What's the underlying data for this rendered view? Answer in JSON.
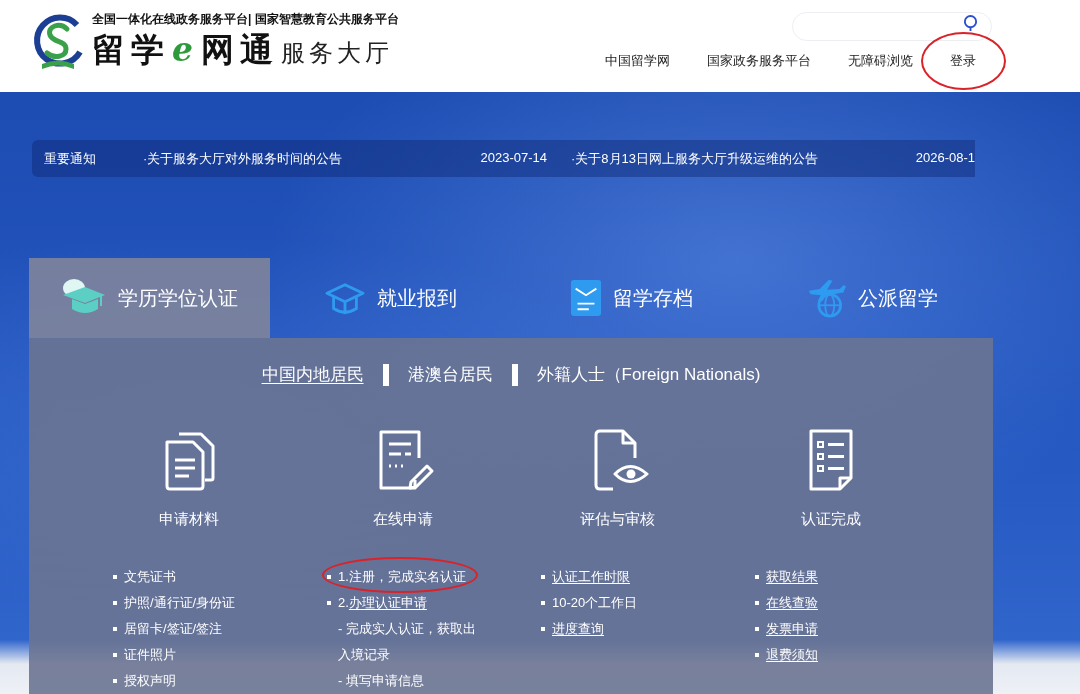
{
  "header": {
    "tagline": "全国一体化在线政务服务平台| 国家智慧教育公共服务平台",
    "logo_text": [
      {
        "text": "留学",
        "kind": "script"
      },
      {
        "text": "e",
        "kind": "accent"
      },
      {
        "text": "网通",
        "kind": "script"
      }
    ],
    "service_name": "服务大厅",
    "nav": [
      {
        "label": "中国留学网",
        "circled": false
      },
      {
        "label": "国家政务服务平台",
        "circled": false
      },
      {
        "label": "无障碍浏览",
        "circled": false
      },
      {
        "label": "登录",
        "circled": true
      }
    ]
  },
  "notice": {
    "label": "重要通知",
    "items": [
      {
        "title": "·关于服务大厅对外服务时间的公告",
        "date": "2023-07-14"
      },
      {
        "title": "·关于8月13日网上服务大厅升级运维的公告",
        "date": "2026-08-1"
      }
    ]
  },
  "tabs": [
    {
      "label": "学历学位认证",
      "selected": true
    },
    {
      "label": "就业报到",
      "selected": false
    },
    {
      "label": "留学存档",
      "selected": false
    },
    {
      "label": "公派留学",
      "selected": false
    }
  ],
  "sub_tabs": [
    {
      "label": "中国内地居民",
      "selected": true
    },
    {
      "label": "港澳台居民",
      "selected": false
    },
    {
      "label": "外籍人士（Foreign Nationals)",
      "selected": false
    }
  ],
  "steps": [
    {
      "title": "申请材料",
      "items": [
        {
          "kind": "bullet",
          "text": "文凭证书",
          "link": false,
          "circled": false
        },
        {
          "kind": "bullet",
          "text": "护照/通行证/身份证",
          "link": false,
          "circled": false
        },
        {
          "kind": "bullet",
          "text": "居留卡/签证/签注",
          "link": false,
          "circled": false
        },
        {
          "kind": "bullet",
          "text": "证件照片",
          "link": false,
          "circled": false
        },
        {
          "kind": "bullet",
          "text": "授权声明",
          "link": false,
          "circled": false
        }
      ]
    },
    {
      "title": "在线申请",
      "items": [
        {
          "kind": "bullet",
          "text": "1.注册，完成实名认证",
          "link": false,
          "circled": true
        },
        {
          "kind": "bullet",
          "prefix": "2.",
          "text": "办理认证申请",
          "link": true,
          "circled": false
        },
        {
          "kind": "dash",
          "text": "- 完成实人认证，获取出入境记录",
          "link": false,
          "circled": false
        },
        {
          "kind": "dash",
          "text": "- 填写申请信息",
          "link": false,
          "circled": false
        }
      ]
    },
    {
      "title": "评估与审核",
      "items": [
        {
          "kind": "bullet",
          "text": "认证工作时限",
          "link": true,
          "circled": false
        },
        {
          "kind": "bullet",
          "text": "10-20个工作日",
          "link": false,
          "circled": false
        },
        {
          "kind": "bullet",
          "text": "进度查询",
          "link": true,
          "circled": false
        }
      ]
    },
    {
      "title": "认证完成",
      "items": [
        {
          "kind": "bullet",
          "text": "获取结果",
          "link": true,
          "circled": false
        },
        {
          "kind": "bullet",
          "text": "在线查验",
          "link": true,
          "circled": false
        },
        {
          "kind": "bullet",
          "text": "发票申请",
          "link": true,
          "circled": false
        },
        {
          "kind": "bullet",
          "text": "退费须知",
          "link": true,
          "circled": false
        }
      ]
    }
  ]
}
